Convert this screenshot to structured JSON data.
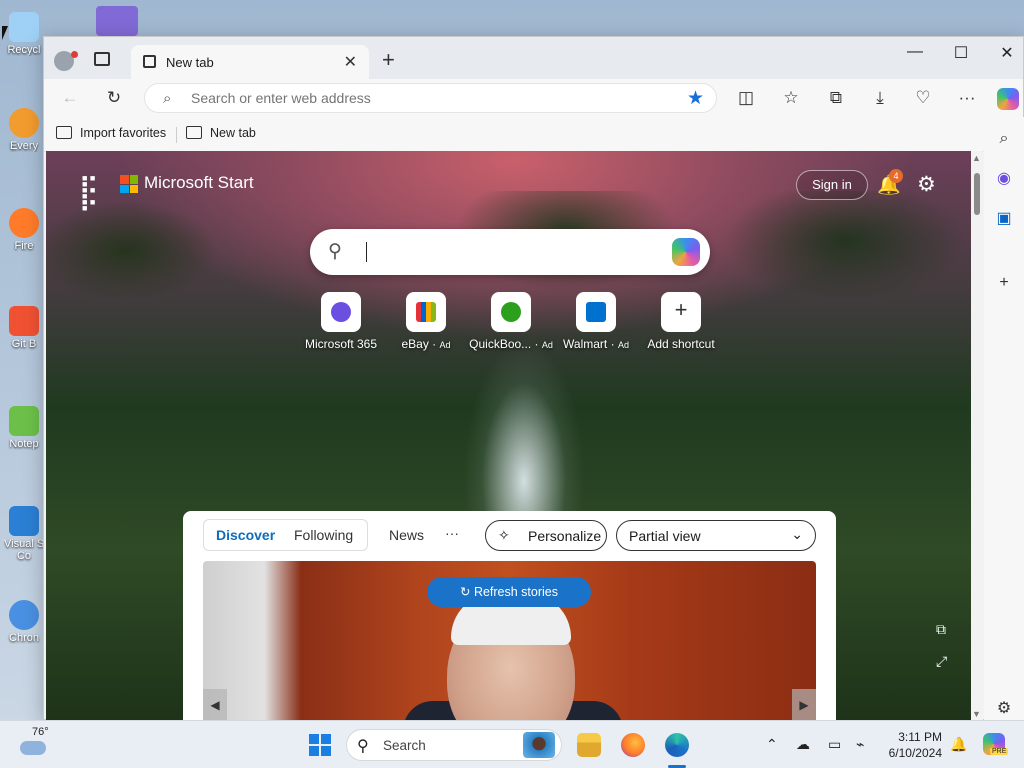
{
  "desktop": {
    "icons": [
      {
        "label": "Recycl",
        "color": "#9fd0f5"
      },
      {
        "label": "Every",
        "color": "#f29b2e"
      },
      {
        "label": "Fire",
        "color": "#ff7b2a"
      },
      {
        "label": "Git B",
        "color": "#f05133"
      },
      {
        "label": "Notep",
        "color": "#6cc04a"
      },
      {
        "label": "Visual S",
        "label2": "Co",
        "color": "#2b7fd4"
      },
      {
        "label": "Chron",
        "color": "#4a90e2"
      }
    ]
  },
  "browser": {
    "tab": {
      "title": "New tab"
    },
    "address_bar": {
      "placeholder": "Search or enter web address"
    },
    "favorites_bar": {
      "items": [
        "Import favorites",
        "New tab"
      ]
    },
    "window_controls": {
      "minimize": "—",
      "maximize": "☐",
      "close": "✕"
    }
  },
  "page": {
    "brand": "Microsoft Start",
    "sign_in": "Sign in",
    "notification_count": "4",
    "shortcuts": [
      {
        "label": "Microsoft 365",
        "ad": "",
        "color": "#6b4fe0"
      },
      {
        "label": "eBay",
        "ad": "Ad",
        "color": "#e53238"
      },
      {
        "label": "QuickBoo...",
        "ad": "Ad",
        "color": "#2ca01c"
      },
      {
        "label": "Walmart",
        "ad": "Ad",
        "color": "#0071ce"
      },
      {
        "label": "Add shortcut",
        "ad": "",
        "color": "#ffffff"
      }
    ],
    "feed": {
      "tabs": [
        "Discover",
        "Following"
      ],
      "active_tab": "Discover",
      "news": "News",
      "more": "···",
      "personalize": "Personalize",
      "view": "Partial view",
      "refresh": "Refresh stories"
    }
  },
  "taskbar": {
    "weather_temp": "76°",
    "search_label": "Search",
    "time": "3:11 PM",
    "date": "6/10/2024",
    "copilot_badge": "PRE"
  },
  "colors": {
    "accent": "#1a73c9",
    "discover_blue": "#0f6cbd"
  }
}
